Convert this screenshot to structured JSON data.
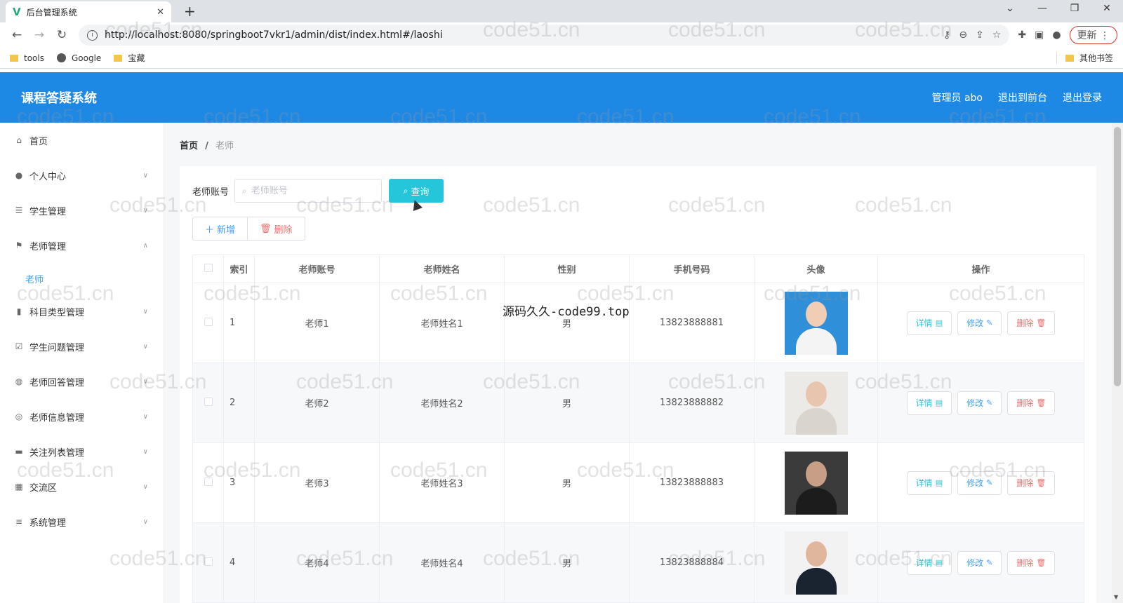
{
  "browser": {
    "tab_title": "后台管理系统",
    "favicon": "V",
    "tab_close": "✕",
    "new_tab": "+",
    "url": "http://localhost:8080/springboot7vkr1/admin/dist/index.html#/laoshi",
    "update_label": "更新",
    "bookmarks": [
      {
        "label": "tools",
        "icon": "folder-icon"
      },
      {
        "label": "Google",
        "icon": "globe-icon"
      },
      {
        "label": "宝藏",
        "icon": "folder-icon"
      }
    ],
    "other_bookmarks": "其他书签"
  },
  "header": {
    "title": "课程答疑系统",
    "links": [
      "管理员 abo",
      "退出到前台",
      "退出登录"
    ],
    "color": "#1e88e5"
  },
  "sidebar": {
    "items": [
      {
        "label": "首页",
        "icon": "home-icon",
        "chevron": ""
      },
      {
        "label": "个人中心",
        "icon": "user-icon",
        "chevron": "∨"
      },
      {
        "label": "学生管理",
        "icon": "list-icon",
        "chevron": "∨"
      },
      {
        "label": "老师管理",
        "icon": "flag-icon",
        "chevron": "∧"
      },
      {
        "label": "老师",
        "icon": "",
        "chevron": "",
        "submenu": true
      },
      {
        "label": "科目类型管理",
        "icon": "bar-chart-icon",
        "chevron": "∨"
      },
      {
        "label": "学生问题管理",
        "icon": "check-square-icon",
        "chevron": "∨"
      },
      {
        "label": "老师回答管理",
        "icon": "globe-icon",
        "chevron": "∨"
      },
      {
        "label": "老师信息管理",
        "icon": "target-icon",
        "chevron": "∨"
      },
      {
        "label": "关注列表管理",
        "icon": "folder-icon",
        "chevron": "∨"
      },
      {
        "label": "交流区",
        "icon": "grid-icon",
        "chevron": "∨"
      },
      {
        "label": "系统管理",
        "icon": "menu-icon",
        "chevron": "∨"
      }
    ]
  },
  "breadcrumb": {
    "home": "首页",
    "sep": "/",
    "current": "老师"
  },
  "search": {
    "label": "老师账号",
    "placeholder": "老师账号",
    "value": "",
    "button": "查询"
  },
  "actions": {
    "add": "新增",
    "delete": "删除"
  },
  "table": {
    "headers": [
      "",
      "索引",
      "老师账号",
      "老师姓名",
      "性别",
      "手机号码",
      "头像",
      "操作"
    ],
    "rows": [
      {
        "index": "1",
        "account": "老师1",
        "name": "老师姓名1",
        "gender": "男",
        "phone": "13823888881"
      },
      {
        "index": "2",
        "account": "老师2",
        "name": "老师姓名2",
        "gender": "男",
        "phone": "13823888882"
      },
      {
        "index": "3",
        "account": "老师3",
        "name": "老师姓名3",
        "gender": "男",
        "phone": "13823888883"
      },
      {
        "index": "4",
        "account": "老师4",
        "name": "老师姓名4",
        "gender": "男",
        "phone": "13823888884"
      }
    ],
    "ops": {
      "detail": "详情",
      "edit": "修改",
      "remove": "删除"
    }
  },
  "overlay": "源码久久-code99.top",
  "watermark": "code51.cn"
}
